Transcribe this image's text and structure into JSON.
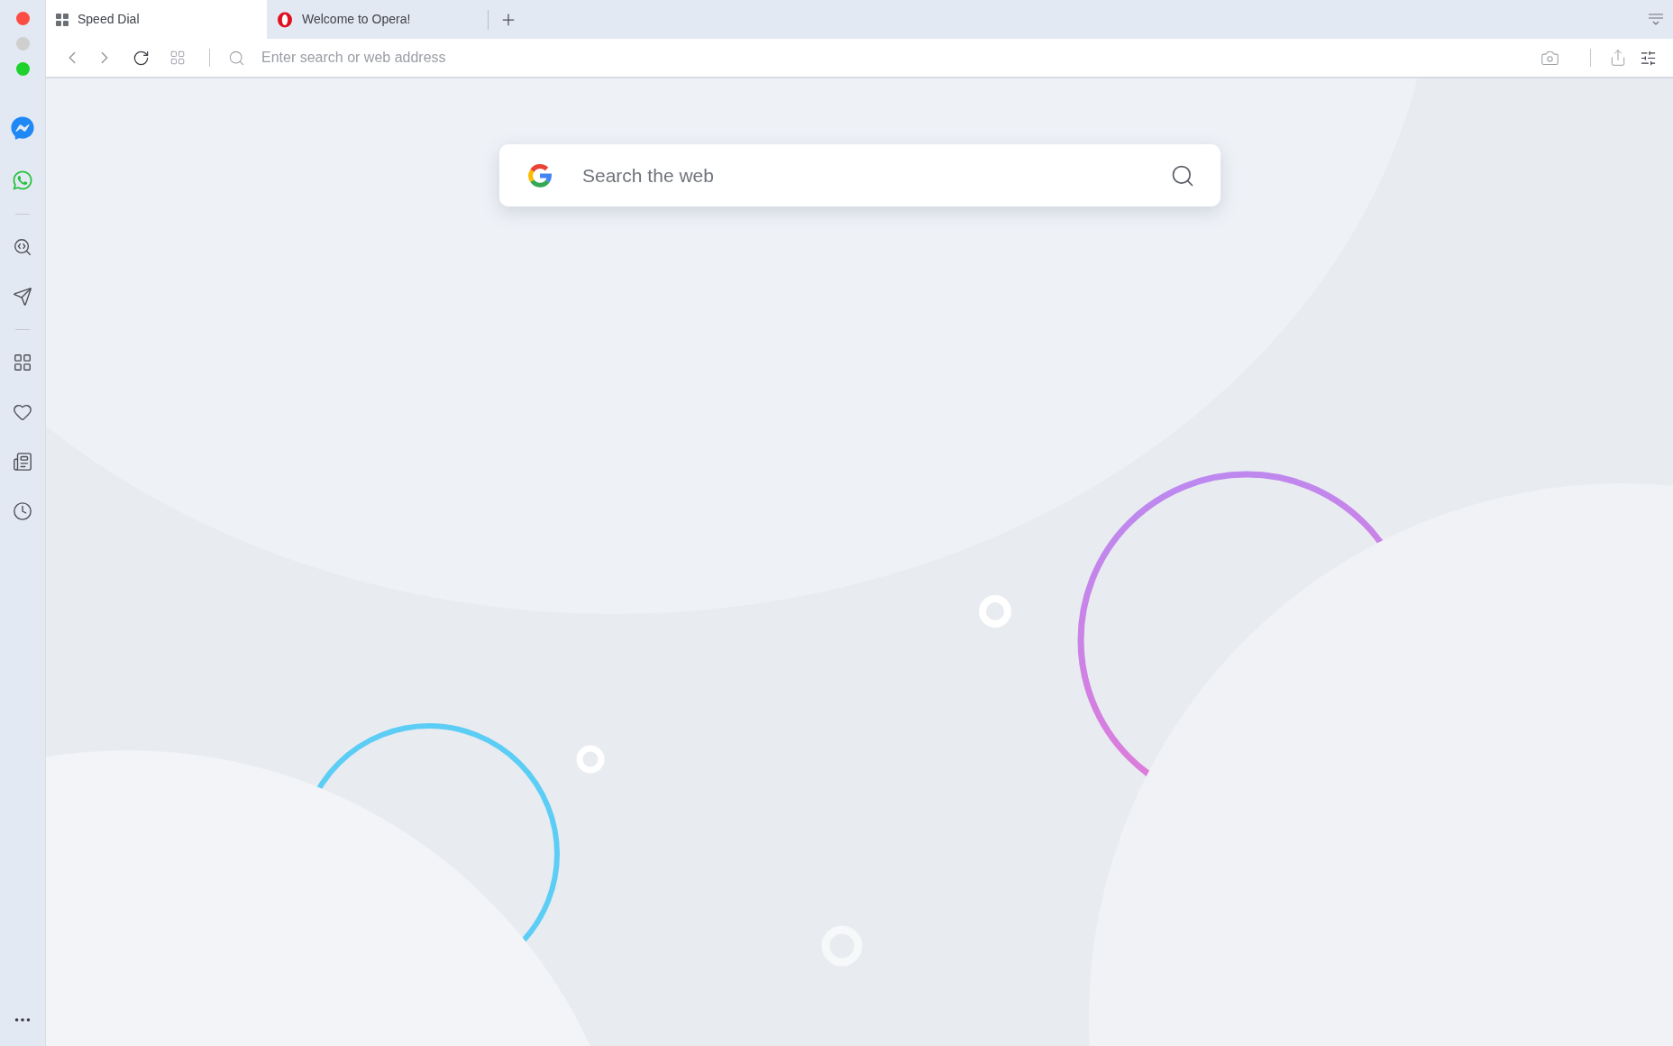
{
  "tabs": [
    {
      "title": "Speed Dial",
      "kind": "speed-dial",
      "selected": true
    },
    {
      "title": "Welcome to Opera!",
      "kind": "opera",
      "selected": false
    }
  ],
  "address_bar": {
    "placeholder": "Enter search or web address"
  },
  "search_box": {
    "placeholder": "Search the web"
  }
}
